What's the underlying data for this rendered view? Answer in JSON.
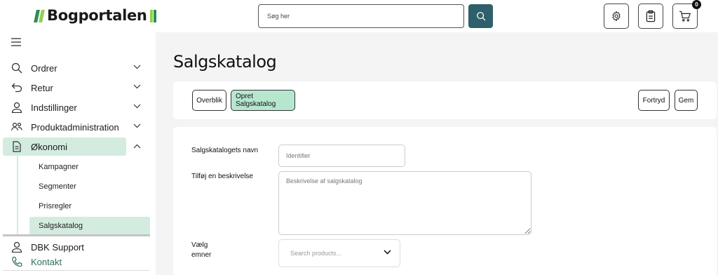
{
  "header": {
    "logo_text": "Bogportalen",
    "search_placeholder": "Søg her",
    "cart_count": "0"
  },
  "sidebar": {
    "items": [
      {
        "label": "Ordrer",
        "icon": "search-icon"
      },
      {
        "label": "Retur",
        "icon": "return-arrow-icon"
      },
      {
        "label": "Indstillinger",
        "icon": "user-icon"
      },
      {
        "label": "Produktadministration",
        "icon": "users-group-icon"
      },
      {
        "label": "Økonomi",
        "icon": "document-icon"
      }
    ],
    "sub_items": [
      "Kampagner",
      "Segmenter",
      "Prisregler",
      "Salgskatalog"
    ],
    "footer_items": [
      {
        "label": "DBK Support",
        "icon": "user-icon"
      },
      {
        "label": "Kontakt",
        "icon": "phone-icon"
      }
    ]
  },
  "main": {
    "title": "Salgskatalog",
    "toolbar": {
      "overview_label": "Overblik",
      "create_label": "Opret Salgskatalog",
      "cancel_label": "Fortryd",
      "save_label": "Gem"
    },
    "form": {
      "name_label": "Salgskatalogets navn",
      "name_placeholder": "Identifier",
      "description_label": "Tilføj en beskrivelse",
      "description_placeholder": "Beskrivelse af salgskatalog",
      "select_label_1": "Vælg",
      "select_label_2": "emner",
      "select_placeholder": "Search products..."
    }
  },
  "colors": {
    "accent_dark": "#2f5f6b",
    "active_bg": "#d3ecdf",
    "primary_button": "#b7e6cf",
    "logo_green": "#2e8b57",
    "logo_lime": "#8fd14f"
  }
}
